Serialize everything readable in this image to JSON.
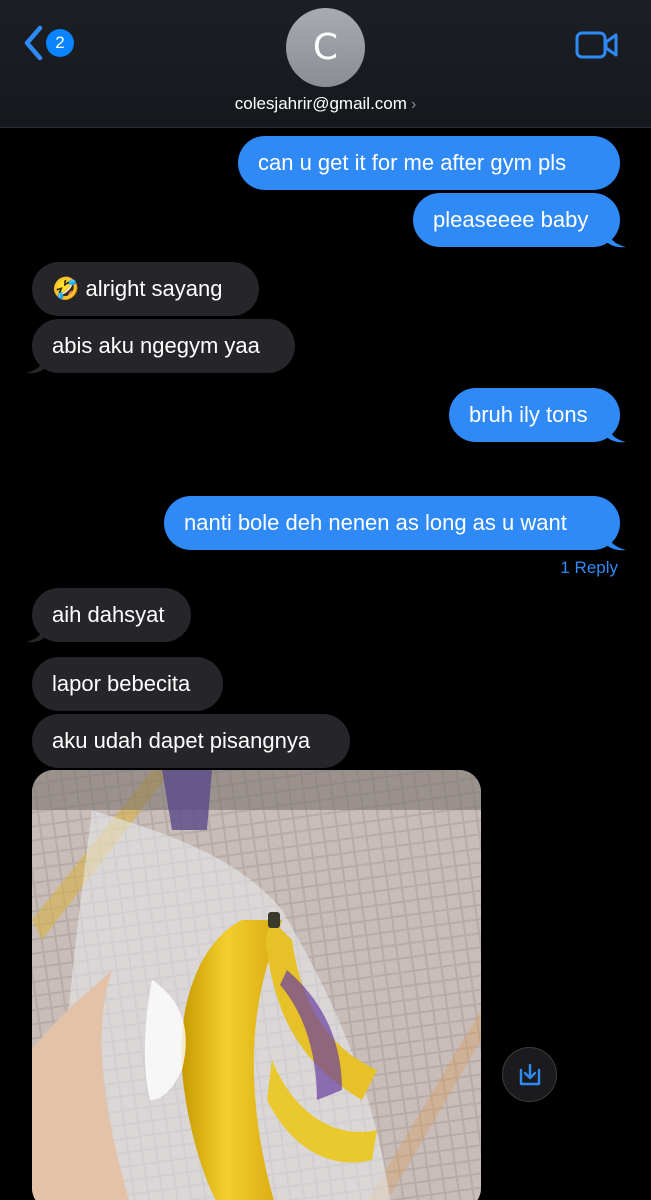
{
  "header": {
    "back_badge": "2",
    "avatar_initial": "C",
    "contact_name": "colesjahrir@gmail.com",
    "contact_chevron": "›"
  },
  "messages": [
    {
      "dir": "out",
      "text": "can u get it for me after gym pls"
    },
    {
      "dir": "out",
      "text": "pleaseeee baby"
    },
    {
      "dir": "in",
      "text": "🤣 alright sayang"
    },
    {
      "dir": "in",
      "text": "abis aku ngegym yaa"
    },
    {
      "dir": "out",
      "text": "bruh ily tons"
    },
    {
      "dir": "out",
      "text": "nanti bole deh nenen as long as u want"
    },
    {
      "dir": "in",
      "text": "aih dahsyat"
    },
    {
      "dir": "in",
      "text": "lapor bebecita"
    },
    {
      "dir": "in",
      "text": "aku udah dapet pisangnya"
    }
  ],
  "reply_label": "1 Reply",
  "colors": {
    "accent": "#2f8af6",
    "incoming_bubble": "#26262a",
    "background": "#000000"
  },
  "icons": [
    "chevron-left-icon",
    "video-camera-icon",
    "save-download-icon"
  ]
}
